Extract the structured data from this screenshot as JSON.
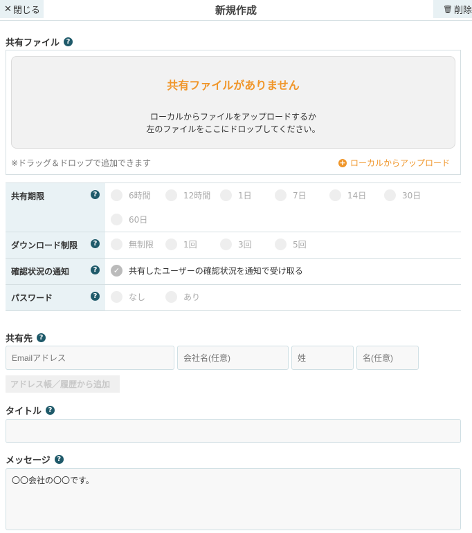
{
  "header": {
    "close_label": "閉じる",
    "title": "新規作成",
    "delete_label": "削除"
  },
  "shared_files": {
    "label": "共有ファイル",
    "empty_title": "共有ファイルがありません",
    "empty_line1": "ローカルからファイルをアップロードするか",
    "empty_line2": "左のファイルをここにドロップしてください。",
    "note": "※ドラッグ＆ドロップで追加できます",
    "upload_label": "ローカルからアップロード"
  },
  "settings": {
    "expiry": {
      "label": "共有期限",
      "options": [
        "6時間",
        "12時間",
        "1日",
        "7日",
        "14日",
        "30日",
        "60日"
      ]
    },
    "download_limit": {
      "label": "ダウンロード制限",
      "options": [
        "無制限",
        "1回",
        "3回",
        "5回"
      ]
    },
    "notify": {
      "label": "確認状況の通知",
      "checkbox_label": "共有したユーザーの確認状況を通知で受け取る",
      "checked": true
    },
    "password": {
      "label": "パスワード",
      "options": [
        "なし",
        "あり"
      ]
    }
  },
  "recipients": {
    "label": "共有先",
    "email_placeholder": "Emailアドレス",
    "company_placeholder": "会社名(任意)",
    "last_name_placeholder": "姓",
    "first_name_placeholder": "名(任意)",
    "address_book_label": "アドレス帳／履歴から追加"
  },
  "title_field": {
    "label": "タイトル",
    "value": ""
  },
  "message_field": {
    "label": "メッセージ",
    "value": "〇〇会社の〇〇です。"
  },
  "colors": {
    "accent": "#f0962a",
    "help": "#1f5a6a"
  }
}
